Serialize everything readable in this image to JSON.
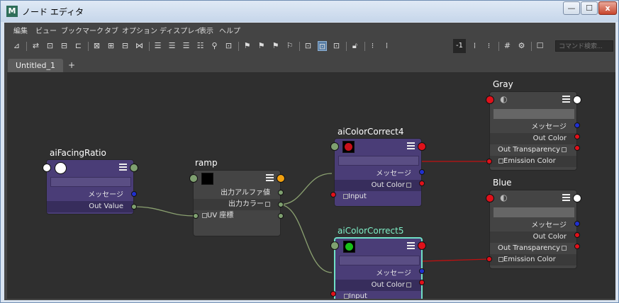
{
  "window": {
    "title": "ノード エディタ",
    "icon": "M",
    "min_label": "—",
    "max_label": "☐",
    "close_label": "x"
  },
  "menu": [
    "編集",
    "ビュー",
    "ブックマーク",
    "タブ",
    "オプション",
    "ディスプレイ",
    "表示",
    "ヘルプ"
  ],
  "toolbar": {
    "search_placeholder": "コマンド検索...",
    "minus_one": "-1"
  },
  "tabs": {
    "active": "Untitled_1",
    "add": "+"
  },
  "nodes": {
    "facing": {
      "title": "aiFacingRatio",
      "rows": [
        "メッセージ",
        "Out Value"
      ]
    },
    "ramp": {
      "title": "ramp",
      "rows": [
        "出力アルファ値",
        "出力カラー",
        "UV 座標"
      ]
    },
    "cc4": {
      "title": "aiColorCorrect4",
      "rows": [
        "メッセージ",
        "Out Color",
        "Input"
      ]
    },
    "cc5": {
      "title": "aiColorCorrect5",
      "rows": [
        "メッセージ",
        "Out Color",
        "Input"
      ]
    },
    "gray": {
      "title": "Gray",
      "rows": [
        "メッセージ",
        "Out Color",
        "Out Transparency",
        "Emission Color"
      ]
    },
    "blue": {
      "title": "Blue",
      "rows": [
        "メッセージ",
        "Out Color",
        "Out Transparency",
        "Emission Color"
      ]
    }
  },
  "colors": {
    "swatch_cc4": "#c8101a",
    "swatch_cc5": "#18c018",
    "swatch_ramp": "#000000",
    "swatch_facing": "#ffffff",
    "wire_red": "#c01010",
    "wire_green": "#8aa070",
    "selected_outline": "#6fe0c6"
  }
}
